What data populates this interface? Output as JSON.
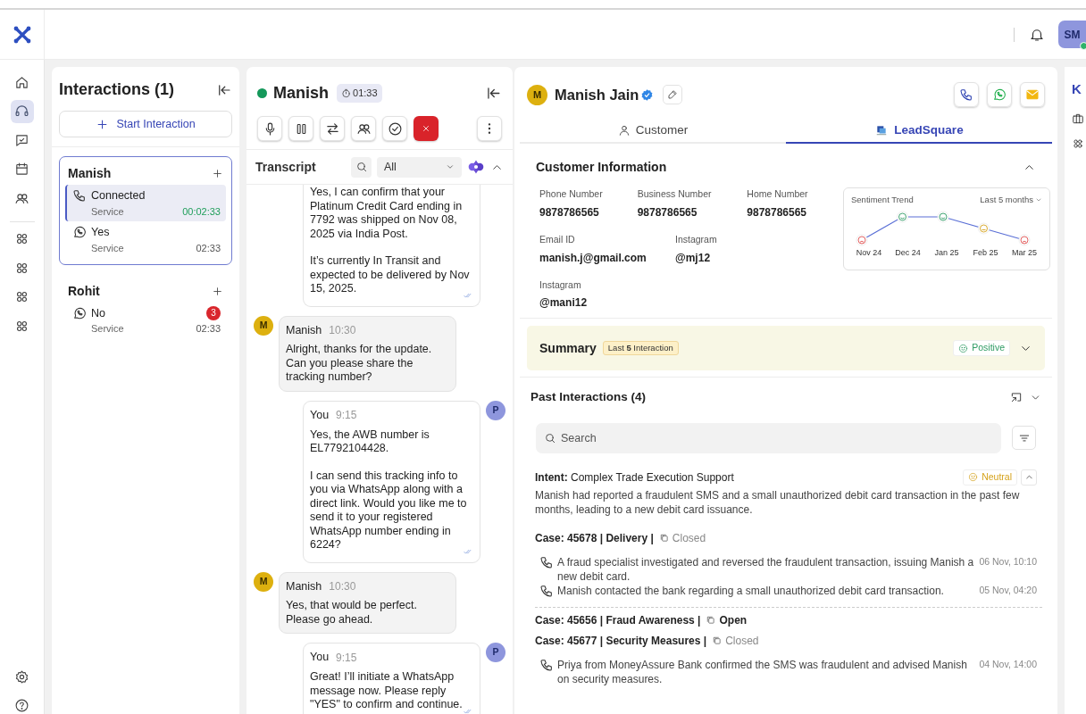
{
  "header": {
    "avatar": "SM",
    "online": true
  },
  "nav": [
    {
      "kind": "home",
      "selected": false
    },
    {
      "kind": "headset",
      "selected": true
    },
    {
      "kind": "chat",
      "selected": false
    },
    {
      "kind": "calendar",
      "selected": false
    },
    {
      "kind": "people",
      "selected": false
    },
    {
      "kind": "apps",
      "selected": false
    },
    {
      "kind": "apps",
      "selected": false
    },
    {
      "kind": "apps",
      "selected": false
    },
    {
      "kind": "apps",
      "selected": false
    }
  ],
  "nav_bottom": [
    {
      "kind": "settings"
    },
    {
      "kind": "help"
    }
  ],
  "interactions": {
    "title": "Interactions (1)",
    "start_button": "Start Interaction",
    "groups": [
      {
        "name": "Manish",
        "selected": true,
        "items": [
          {
            "kind": "call",
            "title": "Connected",
            "subtitle": "Service",
            "time": "00:02:33",
            "live": true,
            "selected": true
          },
          {
            "kind": "whatsapp",
            "title": "Yes",
            "subtitle": "Service",
            "time": "02:33",
            "live": false,
            "selected": false
          }
        ]
      },
      {
        "name": "Rohit",
        "selected": false,
        "items": [
          {
            "kind": "whatsapp",
            "title": "No",
            "subtitle": "Service",
            "time": "02:33",
            "badge": "3",
            "live": false,
            "selected": false
          }
        ]
      }
    ]
  },
  "chat": {
    "name": "Manish",
    "online": true,
    "timer": "01:33",
    "controls": [
      {
        "kind": "mic"
      },
      {
        "kind": "pause"
      },
      {
        "kind": "transfer"
      },
      {
        "kind": "conference"
      },
      {
        "kind": "check"
      },
      {
        "kind": "end"
      }
    ],
    "transcript_title": "Transcript",
    "filter": "All",
    "messages": [
      {
        "kind": "agent",
        "read": true,
        "paragraphs": [
          "Yes, I can confirm that your Platinum Credit Card ending in 7792 was shipped on Nov 08, 2025 via India Post.",
          "It’s currently In Transit and expected to be delivered by Nov 15, 2025."
        ]
      },
      {
        "kind": "customer",
        "avatar": "M",
        "sender": "Manish",
        "time": "10:30",
        "paragraphs": [
          "Alright, thanks for the update. Can you please share the tracking number?"
        ]
      },
      {
        "kind": "agent",
        "avatar": "P",
        "sender": "You",
        "time": "9:15",
        "read": true,
        "paragraphs": [
          "Yes, the AWB number is EL7792104428.",
          "I can send this tracking info to you via WhatsApp along with a direct link. Would you like me to send it to your registered WhatsApp number ending in 6224?"
        ]
      },
      {
        "kind": "customer",
        "avatar": "M",
        "sender": "Manish",
        "time": "10:30",
        "paragraphs": [
          "Yes, that would be perfect. Please go ahead."
        ]
      },
      {
        "kind": "agent",
        "avatar": "P",
        "sender": "You",
        "time": "9:15",
        "read": true,
        "paragraphs": [
          "Great! I’ll initiate a WhatsApp message now. Please reply \"YES\" to confirm and continue."
        ]
      }
    ]
  },
  "customer": {
    "avatar": "M",
    "name": "Manish Jain",
    "verified": true,
    "actions": [
      {
        "kind": "call"
      },
      {
        "kind": "whatsapp"
      },
      {
        "kind": "email"
      }
    ],
    "tabs": [
      {
        "label": "Customer",
        "kind": "person",
        "selected": false
      },
      {
        "label": "LeadSquare",
        "kind": "logo",
        "selected": true
      }
    ],
    "info_title": "Customer Information",
    "field_rows": [
      [
        {
          "label": "Phone Number",
          "value": "9878786565"
        },
        {
          "label": "Business Number",
          "value": "9878786565"
        },
        {
          "label": "Home Number",
          "value": "9878786565"
        }
      ],
      [
        {
          "label": "Email ID",
          "value": "manish.j@gmail.com"
        },
        {
          "label": "Instagram",
          "value": "@mj12"
        }
      ],
      [
        {
          "label": "Instagram",
          "value": "@mani12"
        }
      ]
    ],
    "sentiment_trend": {
      "title": "Sentiment Trend",
      "period": "Last 5 months",
      "points": [
        {
          "label": "Nov 24",
          "kind": "negative"
        },
        {
          "label": "Dec 24",
          "kind": "positive"
        },
        {
          "label": "Jan 25",
          "kind": "positive"
        },
        {
          "label": "Feb 25",
          "kind": "neutral"
        },
        {
          "label": "Mar 25",
          "kind": "negative"
        }
      ]
    },
    "summary": {
      "title": "Summary",
      "badge": "Last **5** Interaction",
      "sentiment": {
        "label": "Positive",
        "kind": "positive"
      }
    },
    "past": {
      "title": "Past Interactions (4)",
      "search_placeholder": "Search",
      "intent_label": "Intent:",
      "intent": "Complex Trade Execution Support",
      "sentiment": {
        "label": "Neutral",
        "kind": "neutral"
      },
      "expanded": true,
      "description": "Manish had reported a fraudulent SMS and a small unauthorized debit card transaction in the past few months, leading to a new debit card issuance.",
      "cases": [
        {
          "title": "Case: 45678 | Delivery |",
          "status": "Closed",
          "open": false,
          "events": [
            {
              "text": "A fraud specialist investigated and reversed the fraudulent transaction, issuing Manish a new debit card.",
              "time": "06 Nov, 10:10"
            },
            {
              "text": "Manish contacted the bank regarding a small unauthorized debit card transaction.",
              "time": "05 Nov, 04:20"
            }
          ]
        },
        {
          "title": "Case: 45656 | Fraud Awareness |",
          "status": "Open",
          "open": true
        },
        {
          "title": "Case: 45677 | Security Measures |",
          "status": "Closed",
          "open": false,
          "events": [
            {
              "text": "Priya from MoneyAssure Bank confirmed the SMS was fraudulent and advised Manish on security measures.",
              "time": "04 Nov, 14:00"
            }
          ]
        }
      ]
    }
  },
  "side_strip": {
    "letter": "K"
  }
}
